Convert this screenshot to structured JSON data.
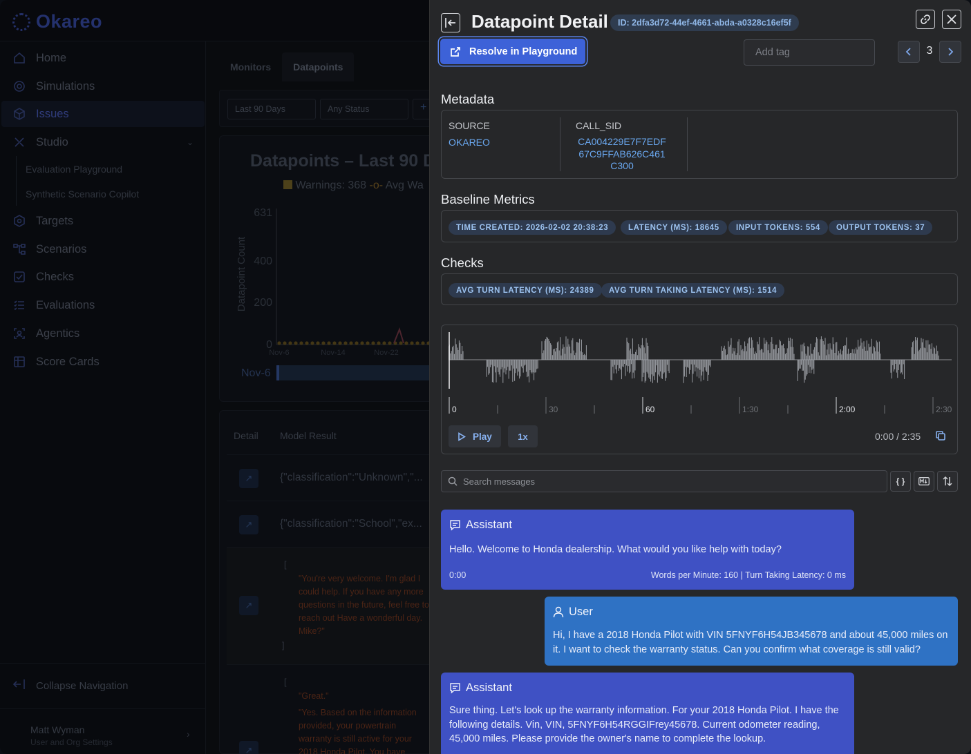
{
  "app": {
    "logo": "Okareo",
    "nav": [
      {
        "label": "Home",
        "icon": "home-icon"
      },
      {
        "label": "Simulations",
        "icon": "simulations-icon"
      },
      {
        "label": "Issues",
        "icon": "issues-icon",
        "active": true
      },
      {
        "label": "Studio",
        "icon": "studio-icon",
        "expanded": true
      },
      {
        "label": "Targets",
        "icon": "targets-icon"
      },
      {
        "label": "Scenarios",
        "icon": "scenarios-icon"
      },
      {
        "label": "Checks",
        "icon": "checks-icon"
      },
      {
        "label": "Evaluations",
        "icon": "evaluations-icon"
      },
      {
        "label": "Agentics",
        "icon": "agentics-icon"
      },
      {
        "label": "Score Cards",
        "icon": "score-cards-icon"
      }
    ],
    "studio_sub": [
      "Evaluation Playground",
      "Synthetic Scenario Copilot"
    ],
    "collapse_label": "Collapse Navigation",
    "user": {
      "name": "Matt Wyman",
      "subtitle": "User and Org Settings"
    },
    "tabs": [
      "Monitors",
      "Datapoints"
    ],
    "active_tab": "Datapoints",
    "filters": [
      "Last 90 Days",
      "Any Status"
    ],
    "chart": {
      "title": "Datapoints – Last 90 D",
      "legend_warnings": "Warnings: 368",
      "legend_avg": "Avg Wa",
      "ylabel": "Datapoint Count",
      "yticks": [
        "631",
        "400",
        "200",
        "0"
      ],
      "xticks": [
        "Nov-6",
        "Nov-14",
        "Nov-22"
      ],
      "range_label": "Nov-6"
    },
    "table": {
      "headers": [
        "Detail",
        "Model Result"
      ],
      "rows": [
        "{\"classification\":\"Unknown\",\"...",
        "{\"classification\":\"School\",\"ex..."
      ],
      "json_row_1": [
        "[",
        "\"You're very welcome. I'm glad I could help. If you have any more questions in the future, feel free to reach out Have a wonderful day. Mike?\"",
        "]"
      ],
      "json_row_2": [
        "[",
        "\"Great.\"",
        "\"Yes. Based on the information provided, your powertrain warranty is still active for your 2018 Honda Pilot. You have"
      ]
    }
  },
  "drawer": {
    "title": "Datapoint Detail",
    "id_badge": "ID: 2dfa3d72-44ef-4661-abda-a0328c16ef5f",
    "resolve_label": "Resolve in Playground",
    "tag_placeholder": "Add tag",
    "page_number": "3",
    "metadata": {
      "heading": "Metadata",
      "source_label": "SOURCE",
      "source_value": "OKAREO",
      "call_sid_label": "CALL_SID",
      "call_sid_lines": [
        "CA004229E7F7EDF",
        "67C9FFAB626C461",
        "C300"
      ]
    },
    "baseline": {
      "heading": "Baseline Metrics",
      "pills": [
        "TIME CREATED: 2026-02-02 20:38:23",
        "LATENCY (MS): 18645",
        "INPUT TOKENS: 554",
        "OUTPUT TOKENS: 37"
      ]
    },
    "checks": {
      "heading": "Checks",
      "pills": [
        "AVG TURN LATENCY (MS): 24389",
        "AVG TURN TAKING LATENCY (MS): 1514"
      ]
    },
    "audio": {
      "ruler_labels": [
        "0",
        "30",
        "60",
        "1:30",
        "2:00",
        "2:30"
      ],
      "play_label": "Play",
      "speed_label": "1x",
      "time_readout": "0:00 / 2:35",
      "playhead_fraction": 0
    },
    "search_placeholder": "Search messages",
    "tools": [
      "{ }",
      "md",
      "sort"
    ],
    "messages": [
      {
        "role": "Assistant",
        "text": "Hello. Welcome to Honda dealership. What would you like help with today?",
        "time": "0:00",
        "stats": "Words per Minute: 160 | Turn Taking Latency: 0 ms"
      },
      {
        "role": "User",
        "text": "Hi, I have a 2018 Honda Pilot with VIN 5FNYF6H54JB345678 and about 45,000 miles on it. I want to check the warranty status. Can you confirm what coverage is still valid?"
      },
      {
        "role": "Assistant",
        "text": "Sure thing. Let's look up the warranty information. For your 2018 Honda Pilot. I have the following details. Vin, VIN, 5FNYF6H54RGGIFrey45678. Current odometer reading, 45,000 miles. Please provide the owner's name to complete the lookup."
      }
    ]
  }
}
